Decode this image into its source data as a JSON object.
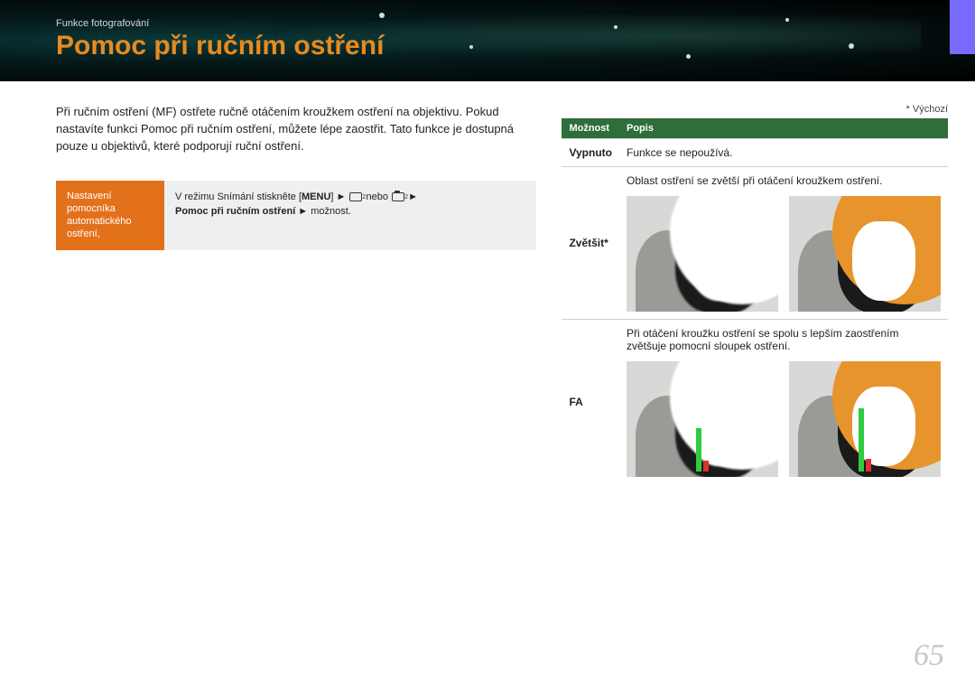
{
  "breadcrumb": "Funkce fotografování",
  "title": "Pomoc při ručním ostření",
  "intro": "Při ručním ostření (MF) ostřete ručně otáčením kroužkem ostření na objektivu. Pokud nastavíte funkci Pomoc při ručním ostření, můžete lépe zaostřit. Tato funkce je dostupná pouze u objektivů, které podporují ruční ostření.",
  "setting": {
    "label": "Nastavení pomocníka automatického ostření,",
    "body_prefix": "V režimu Snímání stiskněte [",
    "menu": "MENU",
    "body_mid1": "] ► ",
    "body_mid2": " nebo ",
    "body_mid3": " ► ",
    "bold2": "Pomoc při ručním ostření",
    "body_suffix": " ► možnost."
  },
  "default_note": "* Výchozí",
  "table": {
    "headers": {
      "option": "Možnost",
      "desc": "Popis"
    },
    "rows": [
      {
        "option": "Vypnuto",
        "desc": "Funkce se nepoužívá."
      },
      {
        "option": "Zvětšit*",
        "desc": "Oblast ostření se zvětší při otáčení kroužkem ostření."
      },
      {
        "option": "FA",
        "desc": "Při otáčení kroužku ostření se spolu s lepším zaostřením zvětšuje pomocní sloupek ostření."
      }
    ]
  },
  "page_number": "65"
}
